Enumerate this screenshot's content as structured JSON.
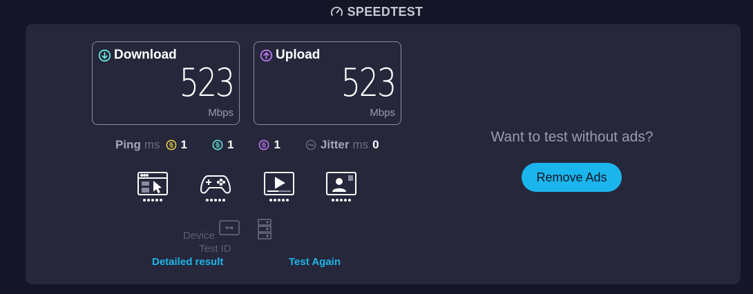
{
  "brand": {
    "title": "SPEEDTEST",
    "icon": "speedometer-icon"
  },
  "download": {
    "label": "Download",
    "value": "523",
    "unit": "Mbps",
    "icon": "arrow-down-circle-icon",
    "color": "#6af0e6"
  },
  "upload": {
    "label": "Upload",
    "value": "523",
    "unit": "Mbps",
    "icon": "arrow-up-circle-icon",
    "color": "#c57bf5"
  },
  "ping": {
    "label": "Ping",
    "unit": "ms",
    "idle": "1",
    "download": "1",
    "upload": "1",
    "idle_color": "#f5d94a",
    "download_color": "#6af0e6",
    "upload_color": "#c57bf5"
  },
  "jitter": {
    "label": "Jitter",
    "unit": "ms",
    "value": "0"
  },
  "services": [
    {
      "name": "web-browsing",
      "icon": "browser-cursor-icon"
    },
    {
      "name": "gaming",
      "icon": "gamepad-icon"
    },
    {
      "name": "video-streaming",
      "icon": "video-play-icon"
    },
    {
      "name": "video-chat",
      "icon": "video-chat-icon"
    }
  ],
  "meta": {
    "device_label": "Device",
    "test_id_label": "Test ID"
  },
  "actions": {
    "detailed_result": "Detailed result",
    "test_again": "Test Again"
  },
  "ads": {
    "prompt": "Want to test without ads?",
    "button": "Remove Ads",
    "accent": "#1ab5ec"
  }
}
